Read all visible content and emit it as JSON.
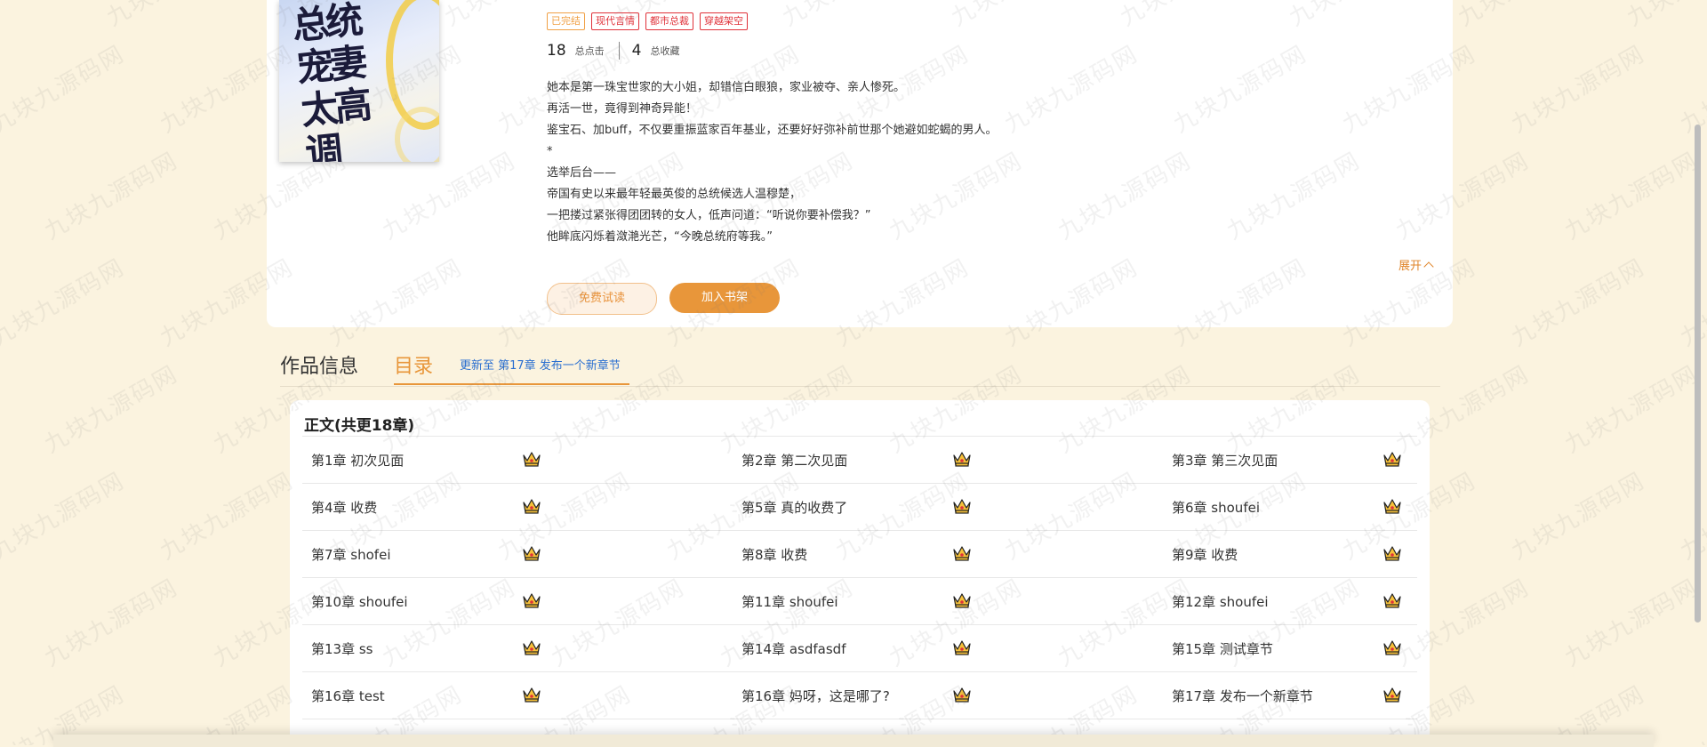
{
  "book": {
    "cover_title": "总统宠妻太高调",
    "tags": [
      {
        "label": "已完结",
        "status": "done"
      },
      {
        "label": "现代言情",
        "status": "genre"
      },
      {
        "label": "都市总裁",
        "status": "genre"
      },
      {
        "label": "穿越架空",
        "status": "genre"
      }
    ],
    "clicks_num": "18",
    "clicks_label": "总点击",
    "favorites_num": "4",
    "favorites_label": "总收藏",
    "description": [
      "她本是第一珠宝世家的大小姐，却错信白眼狼，家业被夺、亲人惨死。",
      "再活一世，竟得到神奇异能！",
      "鉴宝石、加buff，不仅要重振蓝家百年基业，还要好好弥补前世那个她避如蛇蝎的男人。",
      "*",
      "选举后台——",
      "帝国有史以来最年轻最英俊的总统候选人温穆楚，",
      "一把搂过紧张得团团转的女人，低声问道：“听说你要补偿我？”",
      "他眸底闪烁着潋滟光芒，“今晚总统府等我。”"
    ],
    "expand_label": "展开",
    "trial_button": "免费试读",
    "shelf_button": "加入书架"
  },
  "tabs": {
    "info": "作品信息",
    "toc": "目录",
    "update": "更新至 第17章 发布一个新章节"
  },
  "toc": {
    "title": "正文(共更18章)",
    "rows": [
      [
        "第1章 初次见面",
        "第2章 第二次见面",
        "第3章 第三次见面"
      ],
      [
        "第4章 收费",
        "第5章 真的收费了",
        "第6章 shoufei"
      ],
      [
        "第7章 shofei",
        "第8章 收费",
        "第9章 收费"
      ],
      [
        "第10章 shoufei",
        "第11章 shoufei",
        "第12章 shoufei"
      ],
      [
        "第13章 ss",
        "第14章 asdfasdf",
        "第15章 测试章节"
      ],
      [
        "第16章 test",
        "第16章 妈呀，这是哪了?",
        "第17章 发布一个新章节"
      ]
    ]
  },
  "watermark": "九块九源码网",
  "colors": {
    "accent": "#e8963a",
    "tag_red": "#e0323a",
    "link_blue": "#2a6fd0",
    "background": "#fbf3df"
  }
}
